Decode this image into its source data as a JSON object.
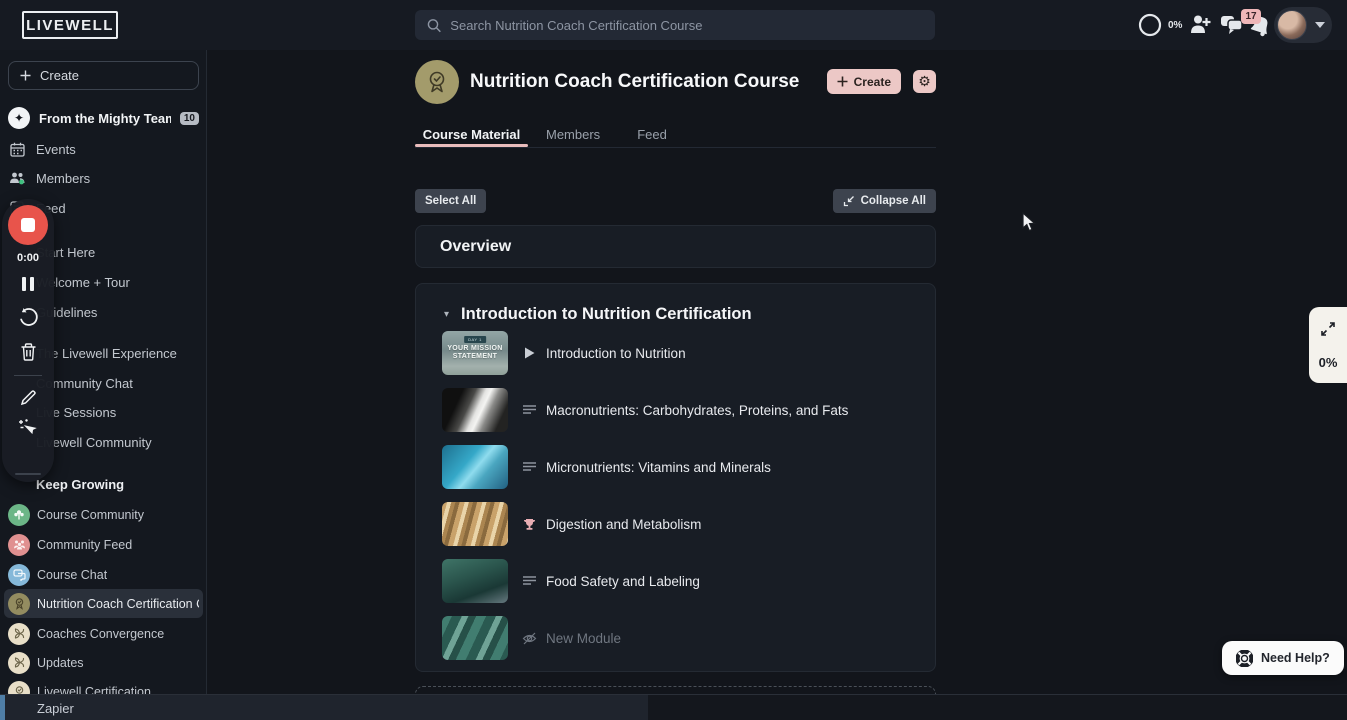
{
  "topbar": {
    "logo": "LIVEWELL",
    "search_placeholder": "Search Nutrition Coach Certification Course",
    "progress_label": "0%",
    "notification_count": "17"
  },
  "sidebar": {
    "create_label": "Create",
    "team": {
      "label": "From the Mighty Team",
      "badge": "10"
    },
    "nav": [
      {
        "label": "Events"
      },
      {
        "label": "Members"
      },
      {
        "label": "Feed"
      }
    ],
    "spaces": [
      {
        "label": "Start Here"
      },
      {
        "label": "Welcome + Tour"
      },
      {
        "label": "Guidelines"
      },
      {
        "label": "The Livewell Experience"
      },
      {
        "label": "Community Chat"
      },
      {
        "label": "Live Sessions"
      },
      {
        "label": "Livewell Community"
      }
    ],
    "section_label": "Keep Growing",
    "courses": [
      {
        "label": "Course Community"
      },
      {
        "label": "Community Feed"
      },
      {
        "label": "Course Chat"
      },
      {
        "label": "Nutrition Coach Certification Course"
      },
      {
        "label": "Coaches Convergence"
      },
      {
        "label": "Updates"
      },
      {
        "label": "Livewell Certification"
      }
    ]
  },
  "recorder": {
    "time": "0:00"
  },
  "header": {
    "title": "Nutrition Coach Certification Course",
    "create_label": "Create",
    "tabs": [
      {
        "label": "Course Material"
      },
      {
        "label": "Members"
      },
      {
        "label": "Feed"
      }
    ]
  },
  "toolbar": {
    "select_all": "Select All",
    "collapse_all": "Collapse All"
  },
  "content": {
    "overview_title": "Overview",
    "module_section": {
      "title": "Introduction to Nutrition Certification",
      "thumb1": {
        "tag": "DAY 1",
        "line1": "YOUR MISSION",
        "line2": "STATEMENT"
      },
      "items": [
        {
          "title": "Introduction to Nutrition"
        },
        {
          "title": "Macronutrients: Carbohydrates, Proteins, and Fats"
        },
        {
          "title": "Micronutrients: Vitamins and Minerals"
        },
        {
          "title": "Digestion and Metabolism"
        },
        {
          "title": "Food Safety and Labeling"
        },
        {
          "title": "New Module"
        }
      ]
    }
  },
  "widgets": {
    "progress_value": "0%",
    "help_label": "Need Help?",
    "statusbar_label": "Zapier"
  },
  "colors": {
    "accent_pink": "#ecc8c6",
    "record_red": "#e8544b",
    "badge_pink": "#efb6b8",
    "tab_underline": "#e9bcbc"
  }
}
